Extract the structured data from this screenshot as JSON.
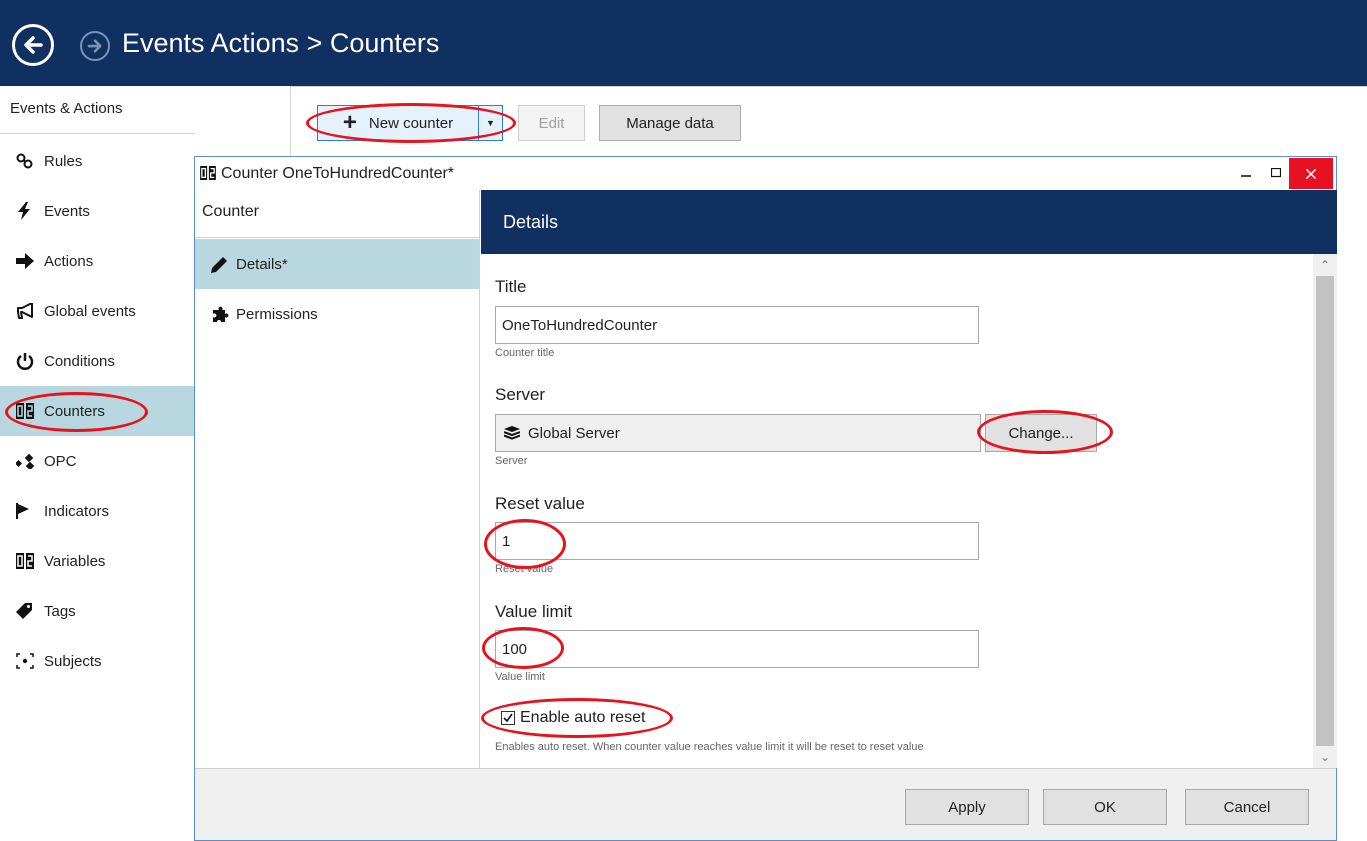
{
  "header": {
    "title": "Events  Actions > Counters",
    "back_icon": "arrow-left-circle-icon",
    "forward_icon": "arrow-right-circle-icon"
  },
  "sidebar": {
    "heading": "Events & Actions",
    "items": [
      {
        "label": "Rules",
        "icon": "rules-icon"
      },
      {
        "label": "Events",
        "icon": "lightning-icon"
      },
      {
        "label": "Actions",
        "icon": "arrow-right-icon"
      },
      {
        "label": "Global events",
        "icon": "megaphone-icon"
      },
      {
        "label": "Conditions",
        "icon": "power-icon"
      },
      {
        "label": "Counters",
        "icon": "counter-icon",
        "active": true
      },
      {
        "label": "OPC",
        "icon": "opc-icon"
      },
      {
        "label": "Indicators",
        "icon": "flag-icon"
      },
      {
        "label": "Variables",
        "icon": "variables-icon"
      },
      {
        "label": "Tags",
        "icon": "tag-icon"
      },
      {
        "label": "Subjects",
        "icon": "subjects-icon"
      }
    ]
  },
  "toolbar": {
    "new_counter": "New counter",
    "edit": "Edit",
    "manage_data": "Manage data"
  },
  "dialog": {
    "title": "Counter OneToHundredCounter*",
    "left_heading": "Counter",
    "tabs": [
      {
        "label": "Details*",
        "icon": "pencil-icon",
        "active": true
      },
      {
        "label": "Permissions",
        "icon": "puzzle-icon"
      }
    ],
    "section_title": "Details",
    "fields": {
      "title_label": "Title",
      "title_value": "OneToHundredCounter",
      "title_hint": "Counter title",
      "server_label": "Server",
      "server_value": "Global Server",
      "server_hint": "Server",
      "change_button": "Change...",
      "reset_label": "Reset value",
      "reset_value": "1",
      "reset_hint": "Reset value",
      "limit_label": "Value limit",
      "limit_value": "100",
      "limit_hint": "Value limit",
      "auto_reset_label": "Enable auto reset",
      "auto_reset_checked": true,
      "auto_reset_hint": "Enables auto reset. When counter value reaches value limit it will be reset to reset value"
    },
    "footer": {
      "apply": "Apply",
      "ok": "OK",
      "cancel": "Cancel"
    }
  },
  "colors": {
    "header_bg": "#0f3060",
    "active_bg": "#b8d7e0",
    "annotation": "#e8121c",
    "close_bg": "#e81123"
  }
}
